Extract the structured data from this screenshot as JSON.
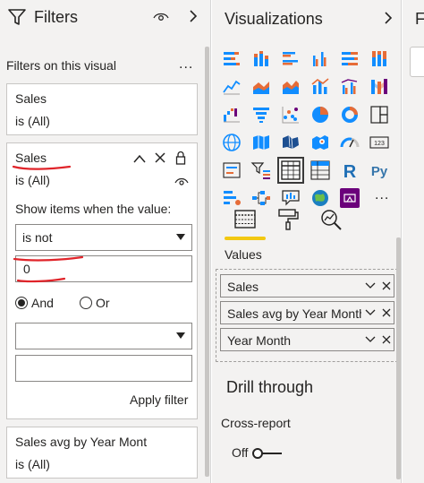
{
  "filters": {
    "title": "Filters",
    "section_title": "Filters on this visual",
    "more": "...",
    "card1": {
      "field": "Sales",
      "value": "is (All)"
    },
    "card2": {
      "field": "Sales",
      "value": "is (All)",
      "show_items_label": "Show items when the value:",
      "condition_select": "is not",
      "condition_value": "0",
      "and_label": "And",
      "or_label": "Or",
      "second_condition_select": "",
      "second_condition_value": "",
      "apply_label": "Apply filter"
    },
    "card3": {
      "field": "Sales avg by Year Mont",
      "value": "is (All)"
    }
  },
  "visualizations": {
    "title": "Visualizations",
    "more": "...",
    "values_label": "Values",
    "value_fields": [
      {
        "label": "Sales"
      },
      {
        "label": "Sales avg by Year Month"
      },
      {
        "label": "Year Month"
      }
    ],
    "drill_through_title": "Drill through",
    "cross_report_label": "Cross-report",
    "toggle_label": "Off"
  },
  "fields": {
    "title": "F"
  },
  "colors": {
    "pane_bg": "#f3f2f1",
    "accent_yellow": "#f2c811",
    "annotation_red": "#e0242a",
    "chart_blue": "#118dff",
    "chart_orange": "#e66c37",
    "chart_purple": "#6b007b"
  }
}
